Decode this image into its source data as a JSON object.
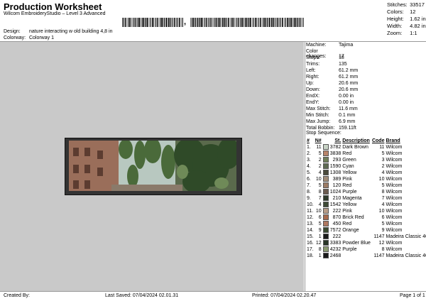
{
  "header": {
    "title": "Production Worksheet",
    "subtitle": "Wilcom EmbroideryStudio – Level 3 Advanced",
    "comma": ","
  },
  "design_info": {
    "design_label": "Design:",
    "design_value": "nature interacting w old building 4,8 in",
    "colorway_label": "Colorway:",
    "colorway_value": "Colorway 1"
  },
  "summary": [
    {
      "label": "Stitches:",
      "value": "33517"
    },
    {
      "label": "Colors:",
      "value": "12"
    },
    {
      "label": "Height:",
      "value": "1.62 in"
    },
    {
      "label": "Width:",
      "value": "4.82 in"
    },
    {
      "label": "Zoom:",
      "value": "1:1"
    }
  ],
  "machine_info": [
    {
      "label": "Machine:",
      "value": "Tajima"
    },
    {
      "label": "Color changes:",
      "value": "17"
    },
    {
      "label": "Stops:",
      "value": "18"
    },
    {
      "label": "Trims:",
      "value": "135"
    },
    {
      "label": "Left:",
      "value": "61.2 mm"
    },
    {
      "label": "Right:",
      "value": "61.2 mm"
    },
    {
      "label": "Up:",
      "value": "20.6 mm"
    },
    {
      "label": "Down:",
      "value": "20.6 mm"
    },
    {
      "label": "EndX:",
      "value": "0.00 in"
    },
    {
      "label": "EndY:",
      "value": "0.00 in"
    },
    {
      "label": "Max Stitch:",
      "value": "11.6 mm"
    },
    {
      "label": "Min Stitch:",
      "value": "0.1 mm"
    },
    {
      "label": "Max Jump:",
      "value": "6.9 mm"
    },
    {
      "label": "Total Bobbin:",
      "value": "159.11ft"
    }
  ],
  "stop_sequence": {
    "title": "Stop Sequence:",
    "headers": [
      "#",
      "N#",
      "",
      "St.",
      "Description",
      "Code",
      "Brand"
    ],
    "rows": [
      {
        "num": "1.",
        "n": "11",
        "color": "#c8d3c6",
        "st": "3782",
        "desc": "Dark Brown",
        "code": "11",
        "brand": "Wilcom"
      },
      {
        "num": "2.",
        "n": "5",
        "color": "#b8846a",
        "st": "3838",
        "desc": "Red",
        "code": "5",
        "brand": "Wilcom"
      },
      {
        "num": "3.",
        "n": "2",
        "color": "#6f7f5a",
        "st": "293",
        "desc": "Green",
        "code": "3",
        "brand": "Wilcom"
      },
      {
        "num": "4.",
        "n": "2",
        "color": "#5d6a52",
        "st": "1590",
        "desc": "Cyan",
        "code": "2",
        "brand": "Wilcom"
      },
      {
        "num": "5.",
        "n": "4",
        "color": "#4a4a3c",
        "st": "1308",
        "desc": "Yellow",
        "code": "4",
        "brand": "Wilcom"
      },
      {
        "num": "6.",
        "n": "10",
        "color": "#a08c78",
        "st": "389",
        "desc": "Pink",
        "code": "10",
        "brand": "Wilcom"
      },
      {
        "num": "7.",
        "n": "5",
        "color": "#9c7c66",
        "st": "120",
        "desc": "Red",
        "code": "5",
        "brand": "Wilcom"
      },
      {
        "num": "8.",
        "n": "8",
        "color": "#6c5c50",
        "st": "1024",
        "desc": "Purple",
        "code": "8",
        "brand": "Wilcom"
      },
      {
        "num": "9.",
        "n": "7",
        "color": "#2e3a2a",
        "st": "210",
        "desc": "Magenta",
        "code": "7",
        "brand": "Wilcom"
      },
      {
        "num": "10.",
        "n": "4",
        "color": "#3e4a36",
        "st": "1542",
        "desc": "Yellow",
        "code": "4",
        "brand": "Wilcom"
      },
      {
        "num": "11.",
        "n": "10",
        "color": "#b89c88",
        "st": "222",
        "desc": "Pink",
        "code": "10",
        "brand": "Wilcom"
      },
      {
        "num": "12.",
        "n": "6",
        "color": "#a86a4c",
        "st": "870",
        "desc": "Brick Red",
        "code": "6",
        "brand": "Wilcom"
      },
      {
        "num": "13.",
        "n": "5",
        "color": "#b07860",
        "st": "450",
        "desc": "Red",
        "code": "5",
        "brand": "Wilcom"
      },
      {
        "num": "14.",
        "n": "9",
        "color": "#3a4a30",
        "st": "7572",
        "desc": "Orange",
        "code": "9",
        "brand": "Wilcom"
      },
      {
        "num": "15.",
        "n": "1",
        "color": "#1a1a1a",
        "st": "222",
        "desc": "",
        "code": "1147",
        "brand": "Madeira Classic 40"
      },
      {
        "num": "16.",
        "n": "12",
        "color": "#2a3628",
        "st": "3383",
        "desc": "Powder Blue",
        "code": "12",
        "brand": "Wilcom"
      },
      {
        "num": "17.",
        "n": "8",
        "color": "#8a9a70",
        "st": "4232",
        "desc": "Purple",
        "code": "8",
        "brand": "Wilcom"
      },
      {
        "num": "18.",
        "n": "1",
        "color": "#1a1a1a",
        "st": "2468",
        "desc": "",
        "code": "1147",
        "brand": "Madeira Classic 40"
      }
    ]
  },
  "footer": {
    "created_by": "Created By:",
    "last_saved": "Last Saved: 07/04/2024 02.01.31",
    "printed": "Printed: 07/04/2024 02.20.47",
    "page": "Page 1 of 1"
  }
}
